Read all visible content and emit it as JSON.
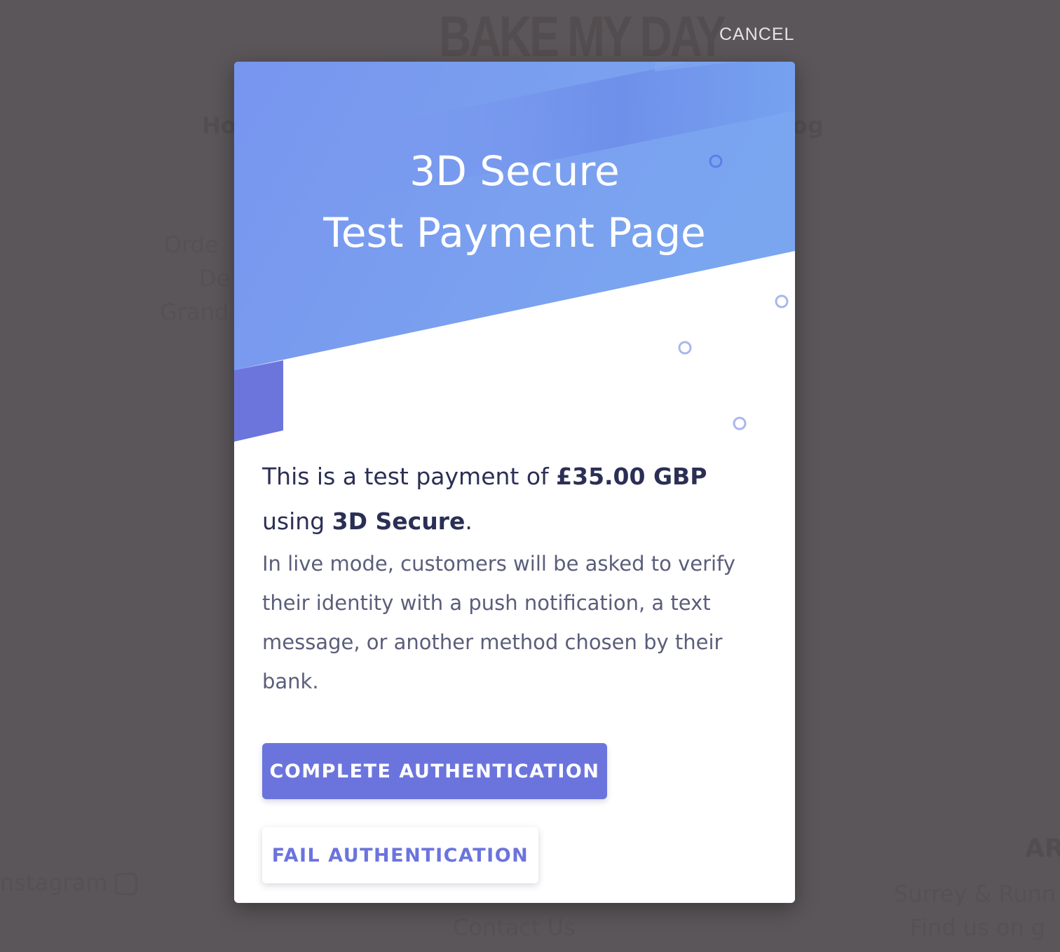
{
  "background_page": {
    "logo_small": "",
    "logo": "BAKE MY DAY",
    "nav_left": "Ho",
    "nav_right": "og",
    "line1": "Orde",
    "line2": "De",
    "line3": "Grand",
    "instagram": "nstagram",
    "area_heading": "ARE",
    "surrey": "Surrey & Runn",
    "find_us": "Find us on g",
    "contact": "Contact Us"
  },
  "cancel_label": "CANCEL",
  "modal": {
    "title_line1": "3D Secure",
    "title_line2": "Test Payment Page",
    "lead_prefix": "This is a test payment of ",
    "amount": "£35.00 GBP",
    "lead_middle": "using ",
    "method": "3D Secure",
    "lead_suffix": ".",
    "description": "In live mode, customers will be asked to verify their identity with a push notification, a text message, or another method chosen by their bank.",
    "complete_button": "COMPLETE AUTHENTICATION",
    "fail_button": "FAIL AUTHENTICATION"
  },
  "colors": {
    "overlay": "#5b5659",
    "hero_light": "#7b9df0",
    "hero_dark": "#6a86ea",
    "accent": "#6b74dd",
    "text_dark": "#2b2f55",
    "text_muted": "#5a5e7a"
  }
}
